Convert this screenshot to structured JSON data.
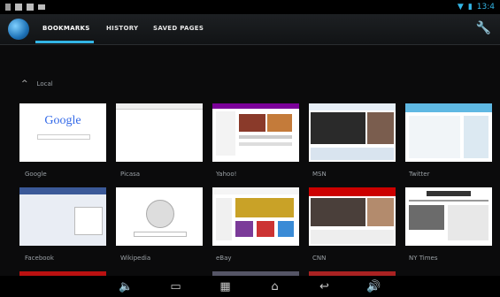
{
  "status": {
    "clock": "13:4"
  },
  "tabs": [
    "BOOKMARKS",
    "HISTORY",
    "SAVED PAGES"
  ],
  "section": {
    "title": "Local"
  },
  "bookmarks": [
    {
      "label": "Google"
    },
    {
      "label": "Picasa"
    },
    {
      "label": "Yahoo!"
    },
    {
      "label": "MSN"
    },
    {
      "label": "Twitter"
    },
    {
      "label": "Facebook"
    },
    {
      "label": "Wikipedia"
    },
    {
      "label": "eBay"
    },
    {
      "label": "CNN"
    },
    {
      "label": "NY Times"
    }
  ],
  "thumb_text": {
    "google": "Google"
  },
  "colors": {
    "accent": "#33b5e5",
    "background": "#0b0b0c"
  }
}
